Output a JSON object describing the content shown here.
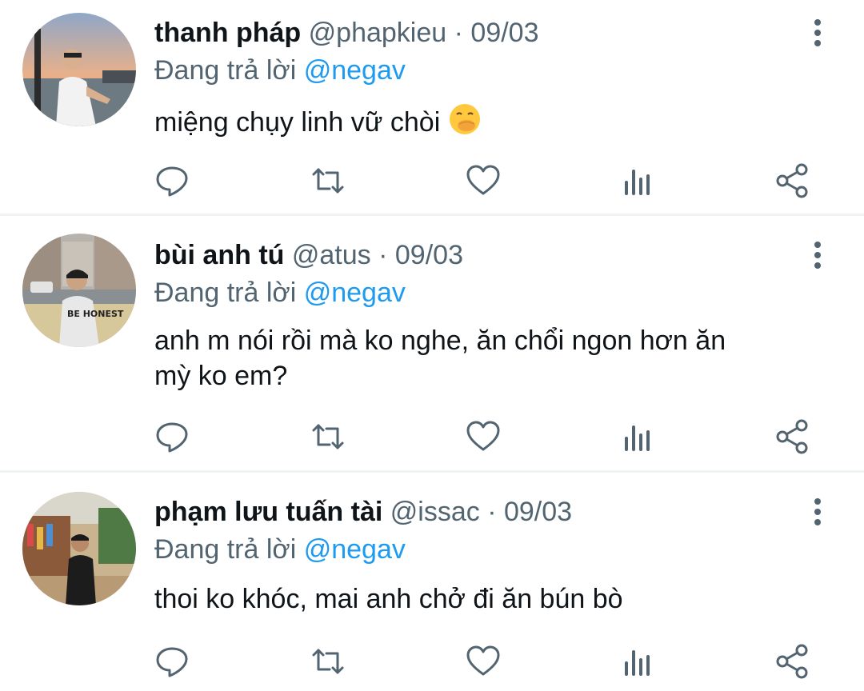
{
  "accent_color": "#1d9bf0",
  "muted_color": "#536471",
  "tweets": [
    {
      "name": "thanh pháp",
      "handle": "@phapkieu",
      "sep": "·",
      "date": "09/03",
      "reply_prefix": "Đang trả lời",
      "reply_to": "@negav",
      "text": "miệng chụy linh vữ chòi",
      "emoji": "face-with-hand-over-mouth-emoji"
    },
    {
      "name": "bùi anh tú",
      "handle": "@atus",
      "sep": "·",
      "date": "09/03",
      "reply_prefix": "Đang trả lời",
      "reply_to": "@negav",
      "text_line1": "anh m nói rồi mà ko nghe, ăn chổi ngon hơn ăn",
      "text_line2": "mỳ ko em?"
    },
    {
      "name": "phạm lưu tuấn tài",
      "handle": "@issac",
      "sep": "·",
      "date": "09/03",
      "reply_prefix": "Đang trả lời",
      "reply_to": "@negav",
      "text": "thoi ko khóc, mai anh chở đi ăn bún bò"
    }
  ],
  "action_icons": [
    "reply-icon",
    "retweet-icon",
    "like-icon",
    "views-icon",
    "share-icon"
  ]
}
